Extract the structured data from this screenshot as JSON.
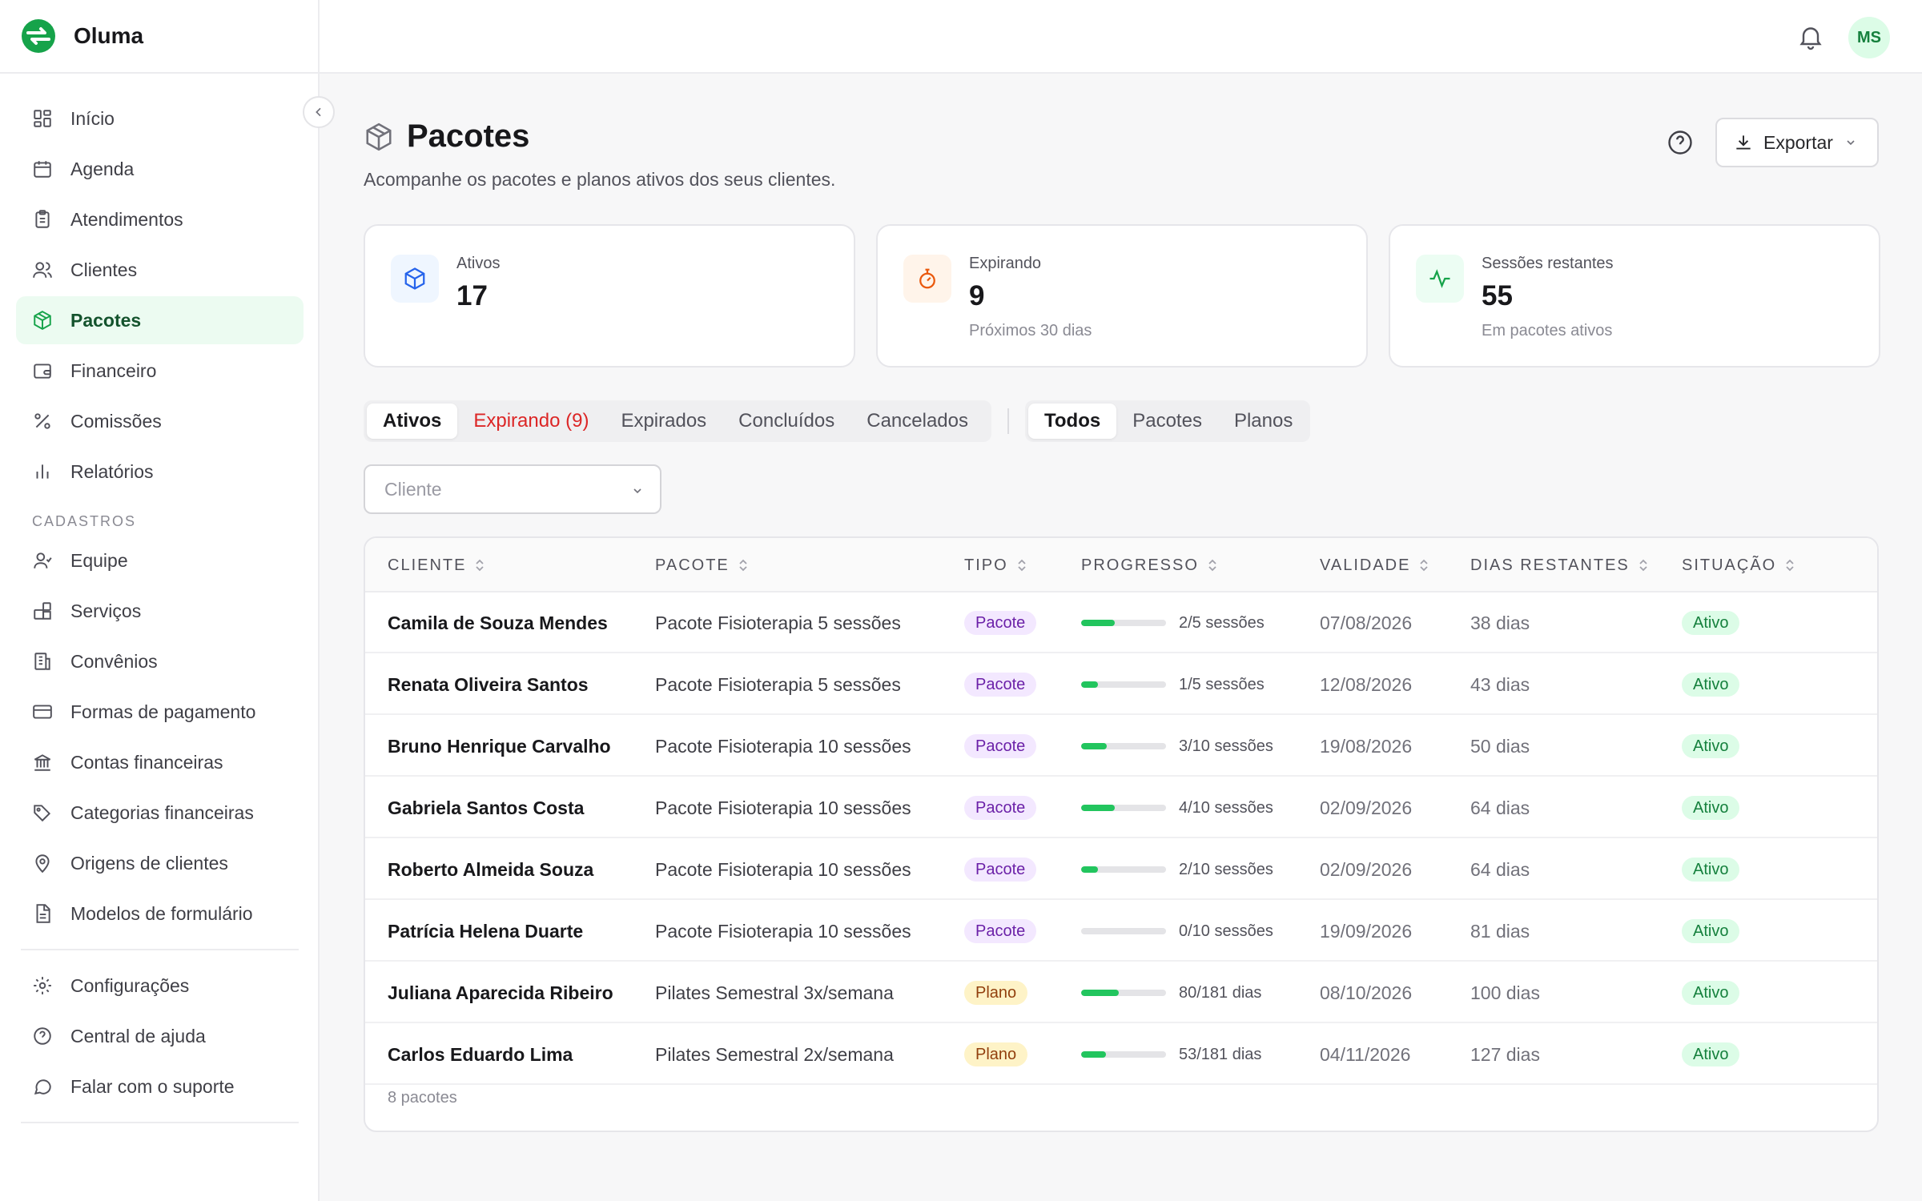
{
  "app": {
    "name": "Oluma",
    "user_initials": "MS"
  },
  "colors": {
    "accent": "#16a34a",
    "active_bg": "#ecfbf1",
    "warning": "#dc2626",
    "progress": "#22c55e"
  },
  "sidebar": {
    "main_items": [
      {
        "label": "Início",
        "icon": "dashboard-icon"
      },
      {
        "label": "Agenda",
        "icon": "calendar-icon"
      },
      {
        "label": "Atendimentos",
        "icon": "clipboard-icon"
      },
      {
        "label": "Clientes",
        "icon": "users-icon"
      },
      {
        "label": "Pacotes",
        "icon": "package-icon",
        "active": true
      },
      {
        "label": "Financeiro",
        "icon": "wallet-icon"
      },
      {
        "label": "Comissões",
        "icon": "percent-icon"
      },
      {
        "label": "Relatórios",
        "icon": "bar-chart-icon"
      }
    ],
    "section_title": "CADASTROS",
    "cadastro_items": [
      {
        "label": "Equipe",
        "icon": "user-icon"
      },
      {
        "label": "Serviços",
        "icon": "blocks-icon"
      },
      {
        "label": "Convênios",
        "icon": "building-icon"
      },
      {
        "label": "Formas de pagamento",
        "icon": "credit-card-icon"
      },
      {
        "label": "Contas financeiras",
        "icon": "bank-icon"
      },
      {
        "label": "Categorias financeiras",
        "icon": "tags-icon"
      },
      {
        "label": "Origens de clientes",
        "icon": "map-pin-icon"
      },
      {
        "label": "Modelos de formulário",
        "icon": "file-icon"
      }
    ],
    "footer_items": [
      {
        "label": "Configurações",
        "icon": "gear-icon"
      },
      {
        "label": "Central de ajuda",
        "icon": "help-circle-icon"
      },
      {
        "label": "Falar com o suporte",
        "icon": "message-icon"
      }
    ]
  },
  "header": {
    "title": "Pacotes",
    "subtitle": "Acompanhe os pacotes e planos ativos dos seus clientes.",
    "export_label": "Exportar"
  },
  "stats": [
    {
      "label": "Ativos",
      "value": "17",
      "note": "",
      "icon": "package-icon"
    },
    {
      "label": "Expirando",
      "value": "9",
      "note": "Próximos 30 dias",
      "icon": "timer-icon"
    },
    {
      "label": "Sessões restantes",
      "value": "55",
      "note": "Em pacotes ativos",
      "icon": "activity-icon"
    }
  ],
  "status_tabs": [
    "Ativos",
    "Expirando (9)",
    "Expirados",
    "Concluídos",
    "Cancelados"
  ],
  "type_tabs": [
    "Todos",
    "Pacotes",
    "Planos"
  ],
  "filter": {
    "client_placeholder": "Cliente"
  },
  "table": {
    "columns": [
      "CLIENTE",
      "PACOTE",
      "TIPO",
      "PROGRESSO",
      "VALIDADE",
      "DIAS RESTANTES",
      "SITUAÇÃO"
    ],
    "rows": [
      {
        "cliente": "Camila de Souza Mendes",
        "pacote": "Pacote Fisioterapia 5 sessões",
        "tipo": "Pacote",
        "progress_fraction": 0.4,
        "progress_text": "2/5 sessões",
        "validade": "07/08/2026",
        "dias": "38 dias",
        "situacao": "Ativo"
      },
      {
        "cliente": "Renata Oliveira Santos",
        "pacote": "Pacote Fisioterapia 5 sessões",
        "tipo": "Pacote",
        "progress_fraction": 0.2,
        "progress_text": "1/5 sessões",
        "validade": "12/08/2026",
        "dias": "43 dias",
        "situacao": "Ativo"
      },
      {
        "cliente": "Bruno Henrique Carvalho",
        "pacote": "Pacote Fisioterapia 10 sessões",
        "tipo": "Pacote",
        "progress_fraction": 0.3,
        "progress_text": "3/10 sessões",
        "validade": "19/08/2026",
        "dias": "50 dias",
        "situacao": "Ativo"
      },
      {
        "cliente": "Gabriela Santos Costa",
        "pacote": "Pacote Fisioterapia 10 sessões",
        "tipo": "Pacote",
        "progress_fraction": 0.4,
        "progress_text": "4/10 sessões",
        "validade": "02/09/2026",
        "dias": "64 dias",
        "situacao": "Ativo"
      },
      {
        "cliente": "Roberto Almeida Souza",
        "pacote": "Pacote Fisioterapia 10 sessões",
        "tipo": "Pacote",
        "progress_fraction": 0.2,
        "progress_text": "2/10 sessões",
        "validade": "02/09/2026",
        "dias": "64 dias",
        "situacao": "Ativo"
      },
      {
        "cliente": "Patrícia Helena Duarte",
        "pacote": "Pacote Fisioterapia 10 sessões",
        "tipo": "Pacote",
        "progress_fraction": 0.0,
        "progress_text": "0/10 sessões",
        "validade": "19/09/2026",
        "dias": "81 dias",
        "situacao": "Ativo"
      },
      {
        "cliente": "Juliana Aparecida Ribeiro",
        "pacote": "Pilates Semestral 3x/semana",
        "tipo": "Plano",
        "progress_fraction": 0.442,
        "progress_text": "80/181 dias",
        "validade": "08/10/2026",
        "dias": "100 dias",
        "situacao": "Ativo"
      },
      {
        "cliente": "Carlos Eduardo Lima",
        "pacote": "Pilates Semestral 2x/semana",
        "tipo": "Plano",
        "progress_fraction": 0.293,
        "progress_text": "53/181 dias",
        "validade": "04/11/2026",
        "dias": "127 dias",
        "situacao": "Ativo"
      }
    ],
    "footer": "8 pacotes"
  }
}
